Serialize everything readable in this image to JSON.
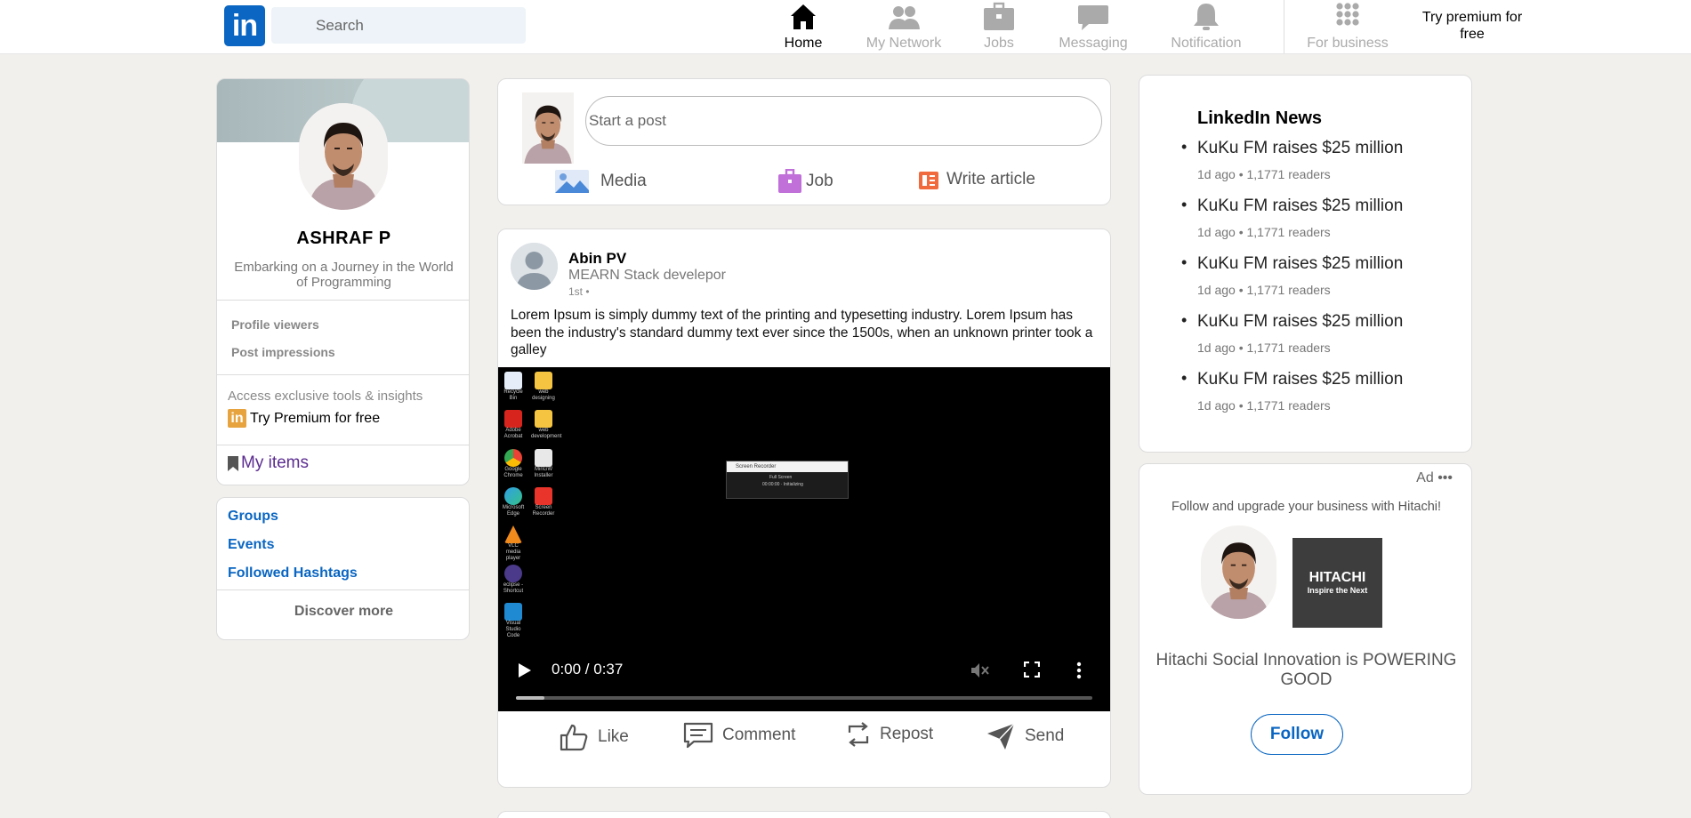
{
  "nav": {
    "logo_text": "in",
    "search_placeholder": "Search",
    "items": [
      {
        "label": "Home",
        "icon": "home-icon",
        "active": true
      },
      {
        "label": "My Network",
        "icon": "network-icon",
        "active": false
      },
      {
        "label": "Jobs",
        "icon": "briefcase-icon",
        "active": false
      },
      {
        "label": "Messaging",
        "icon": "chat-icon",
        "active": false
      },
      {
        "label": "Notification",
        "icon": "bell-icon",
        "active": false
      },
      {
        "label": "For business",
        "icon": "grid-icon",
        "active": false
      }
    ],
    "premium_link": "Try premium for free"
  },
  "profile": {
    "name": "ASHRAF P",
    "tagline": "Embarking on a Journey in the World of Programming",
    "stats": [
      "Profile viewers",
      "Post impressions"
    ],
    "premium_text": "Access exclusive tools & insights",
    "premium_try_icon": "in",
    "premium_try": "Try Premium for free",
    "my_items": "My items"
  },
  "side_links": {
    "items": [
      "Groups",
      "Events",
      "Followed Hashtags"
    ],
    "discover_more": "Discover more"
  },
  "composer": {
    "placeholder": "Start a post",
    "actions": {
      "media": "Media",
      "job": "Job",
      "article": "Write article"
    }
  },
  "post": {
    "author": "Abin PV",
    "role": "MEARN Stack develepor",
    "degree": "1st •",
    "body": "Lorem Ipsum is simply dummy text of the printing and typesetting industry. Lorem Ipsum has been the industry's standard dummy text ever since the 1500s, when an unknown printer took a galley",
    "video": {
      "time": "0:00 / 0:37",
      "progress": 0.05,
      "desktop_icons": [
        "Recycle Bin",
        "web designing",
        "Adobe Acrobat",
        "web development",
        "Google Chrome",
        "MinGW Installer",
        "Microsoft Edge",
        "Screen Recorder",
        "VLC media player",
        "eclipse - Shortcut",
        "Visual Studio Code"
      ],
      "recorder_title": "Screen Recorder",
      "recorder_mode": "Full Screen",
      "recorder_status": "00:00:00 · Initializing"
    },
    "actions": {
      "like": "Like",
      "comment": "Comment",
      "repost": "Repost",
      "send": "Send"
    }
  },
  "news": {
    "title": "LinkedIn News",
    "items": [
      {
        "headline": "KuKu FM raises $25 million",
        "meta": "1d ago • 1,1771 readers"
      },
      {
        "headline": "KuKu FM raises $25 million",
        "meta": "1d ago • 1,1771 readers"
      },
      {
        "headline": "KuKu FM raises $25 million",
        "meta": "1d ago • 1,1771 readers"
      },
      {
        "headline": "KuKu FM raises $25 million",
        "meta": "1d ago • 1,1771 readers"
      },
      {
        "headline": "KuKu FM raises $25 million",
        "meta": "1d ago • 1,1771 readers"
      }
    ]
  },
  "ad": {
    "label": "Ad •••",
    "description": "Follow and upgrade your business with Hitachi!",
    "brand": "HITACHI",
    "slogan": "Inspire the Next",
    "tagline": "Hitachi Social Innovation is POWERING GOOD",
    "follow": "Follow"
  },
  "colors": {
    "brand": "#0a66c2",
    "background": "#f1f0ed",
    "premium": "#e7a33e",
    "my_items": "#5c2d91"
  }
}
